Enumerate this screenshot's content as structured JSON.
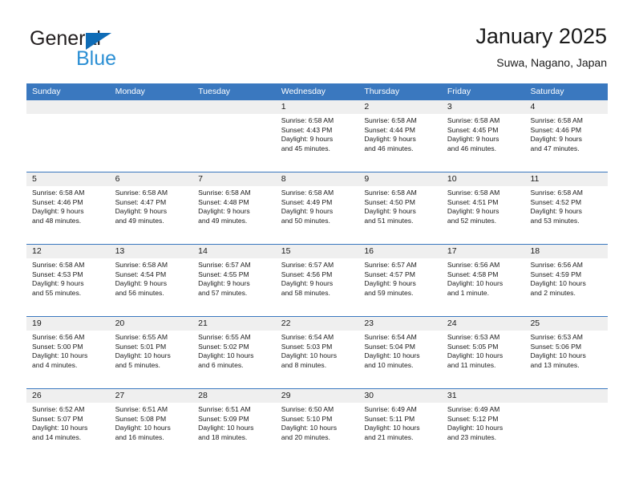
{
  "brand": {
    "name_dark": "General",
    "name_blue": "Blue",
    "logo_blue": "#0f6cb6",
    "text_blue": "#2b8fd4"
  },
  "header": {
    "title": "January 2025",
    "subtitle": "Suwa, Nagano, Japan"
  },
  "theme": {
    "header_blue": "#3a78bf",
    "daynum_band": "#efefef",
    "text": "#1a1a1a"
  },
  "calendar": {
    "weekdays": [
      "Sunday",
      "Monday",
      "Tuesday",
      "Wednesday",
      "Thursday",
      "Friday",
      "Saturday"
    ],
    "weeks": [
      [
        {
          "day": "",
          "empty": true
        },
        {
          "day": "",
          "empty": true
        },
        {
          "day": "",
          "empty": true
        },
        {
          "day": "1",
          "sunrise": "Sunrise: 6:58 AM",
          "sunset": "Sunset: 4:43 PM",
          "daylight1": "Daylight: 9 hours",
          "daylight2": "and 45 minutes."
        },
        {
          "day": "2",
          "sunrise": "Sunrise: 6:58 AM",
          "sunset": "Sunset: 4:44 PM",
          "daylight1": "Daylight: 9 hours",
          "daylight2": "and 46 minutes."
        },
        {
          "day": "3",
          "sunrise": "Sunrise: 6:58 AM",
          "sunset": "Sunset: 4:45 PM",
          "daylight1": "Daylight: 9 hours",
          "daylight2": "and 46 minutes."
        },
        {
          "day": "4",
          "sunrise": "Sunrise: 6:58 AM",
          "sunset": "Sunset: 4:46 PM",
          "daylight1": "Daylight: 9 hours",
          "daylight2": "and 47 minutes."
        }
      ],
      [
        {
          "day": "5",
          "sunrise": "Sunrise: 6:58 AM",
          "sunset": "Sunset: 4:46 PM",
          "daylight1": "Daylight: 9 hours",
          "daylight2": "and 48 minutes."
        },
        {
          "day": "6",
          "sunrise": "Sunrise: 6:58 AM",
          "sunset": "Sunset: 4:47 PM",
          "daylight1": "Daylight: 9 hours",
          "daylight2": "and 49 minutes."
        },
        {
          "day": "7",
          "sunrise": "Sunrise: 6:58 AM",
          "sunset": "Sunset: 4:48 PM",
          "daylight1": "Daylight: 9 hours",
          "daylight2": "and 49 minutes."
        },
        {
          "day": "8",
          "sunrise": "Sunrise: 6:58 AM",
          "sunset": "Sunset: 4:49 PM",
          "daylight1": "Daylight: 9 hours",
          "daylight2": "and 50 minutes."
        },
        {
          "day": "9",
          "sunrise": "Sunrise: 6:58 AM",
          "sunset": "Sunset: 4:50 PM",
          "daylight1": "Daylight: 9 hours",
          "daylight2": "and 51 minutes."
        },
        {
          "day": "10",
          "sunrise": "Sunrise: 6:58 AM",
          "sunset": "Sunset: 4:51 PM",
          "daylight1": "Daylight: 9 hours",
          "daylight2": "and 52 minutes."
        },
        {
          "day": "11",
          "sunrise": "Sunrise: 6:58 AM",
          "sunset": "Sunset: 4:52 PM",
          "daylight1": "Daylight: 9 hours",
          "daylight2": "and 53 minutes."
        }
      ],
      [
        {
          "day": "12",
          "sunrise": "Sunrise: 6:58 AM",
          "sunset": "Sunset: 4:53 PM",
          "daylight1": "Daylight: 9 hours",
          "daylight2": "and 55 minutes."
        },
        {
          "day": "13",
          "sunrise": "Sunrise: 6:58 AM",
          "sunset": "Sunset: 4:54 PM",
          "daylight1": "Daylight: 9 hours",
          "daylight2": "and 56 minutes."
        },
        {
          "day": "14",
          "sunrise": "Sunrise: 6:57 AM",
          "sunset": "Sunset: 4:55 PM",
          "daylight1": "Daylight: 9 hours",
          "daylight2": "and 57 minutes."
        },
        {
          "day": "15",
          "sunrise": "Sunrise: 6:57 AM",
          "sunset": "Sunset: 4:56 PM",
          "daylight1": "Daylight: 9 hours",
          "daylight2": "and 58 minutes."
        },
        {
          "day": "16",
          "sunrise": "Sunrise: 6:57 AM",
          "sunset": "Sunset: 4:57 PM",
          "daylight1": "Daylight: 9 hours",
          "daylight2": "and 59 minutes."
        },
        {
          "day": "17",
          "sunrise": "Sunrise: 6:56 AM",
          "sunset": "Sunset: 4:58 PM",
          "daylight1": "Daylight: 10 hours",
          "daylight2": "and 1 minute."
        },
        {
          "day": "18",
          "sunrise": "Sunrise: 6:56 AM",
          "sunset": "Sunset: 4:59 PM",
          "daylight1": "Daylight: 10 hours",
          "daylight2": "and 2 minutes."
        }
      ],
      [
        {
          "day": "19",
          "sunrise": "Sunrise: 6:56 AM",
          "sunset": "Sunset: 5:00 PM",
          "daylight1": "Daylight: 10 hours",
          "daylight2": "and 4 minutes."
        },
        {
          "day": "20",
          "sunrise": "Sunrise: 6:55 AM",
          "sunset": "Sunset: 5:01 PM",
          "daylight1": "Daylight: 10 hours",
          "daylight2": "and 5 minutes."
        },
        {
          "day": "21",
          "sunrise": "Sunrise: 6:55 AM",
          "sunset": "Sunset: 5:02 PM",
          "daylight1": "Daylight: 10 hours",
          "daylight2": "and 6 minutes."
        },
        {
          "day": "22",
          "sunrise": "Sunrise: 6:54 AM",
          "sunset": "Sunset: 5:03 PM",
          "daylight1": "Daylight: 10 hours",
          "daylight2": "and 8 minutes."
        },
        {
          "day": "23",
          "sunrise": "Sunrise: 6:54 AM",
          "sunset": "Sunset: 5:04 PM",
          "daylight1": "Daylight: 10 hours",
          "daylight2": "and 10 minutes."
        },
        {
          "day": "24",
          "sunrise": "Sunrise: 6:53 AM",
          "sunset": "Sunset: 5:05 PM",
          "daylight1": "Daylight: 10 hours",
          "daylight2": "and 11 minutes."
        },
        {
          "day": "25",
          "sunrise": "Sunrise: 6:53 AM",
          "sunset": "Sunset: 5:06 PM",
          "daylight1": "Daylight: 10 hours",
          "daylight2": "and 13 minutes."
        }
      ],
      [
        {
          "day": "26",
          "sunrise": "Sunrise: 6:52 AM",
          "sunset": "Sunset: 5:07 PM",
          "daylight1": "Daylight: 10 hours",
          "daylight2": "and 14 minutes."
        },
        {
          "day": "27",
          "sunrise": "Sunrise: 6:51 AM",
          "sunset": "Sunset: 5:08 PM",
          "daylight1": "Daylight: 10 hours",
          "daylight2": "and 16 minutes."
        },
        {
          "day": "28",
          "sunrise": "Sunrise: 6:51 AM",
          "sunset": "Sunset: 5:09 PM",
          "daylight1": "Daylight: 10 hours",
          "daylight2": "and 18 minutes."
        },
        {
          "day": "29",
          "sunrise": "Sunrise: 6:50 AM",
          "sunset": "Sunset: 5:10 PM",
          "daylight1": "Daylight: 10 hours",
          "daylight2": "and 20 minutes."
        },
        {
          "day": "30",
          "sunrise": "Sunrise: 6:49 AM",
          "sunset": "Sunset: 5:11 PM",
          "daylight1": "Daylight: 10 hours",
          "daylight2": "and 21 minutes."
        },
        {
          "day": "31",
          "sunrise": "Sunrise: 6:49 AM",
          "sunset": "Sunset: 5:12 PM",
          "daylight1": "Daylight: 10 hours",
          "daylight2": "and 23 minutes."
        },
        {
          "day": "",
          "empty": true
        }
      ]
    ]
  }
}
